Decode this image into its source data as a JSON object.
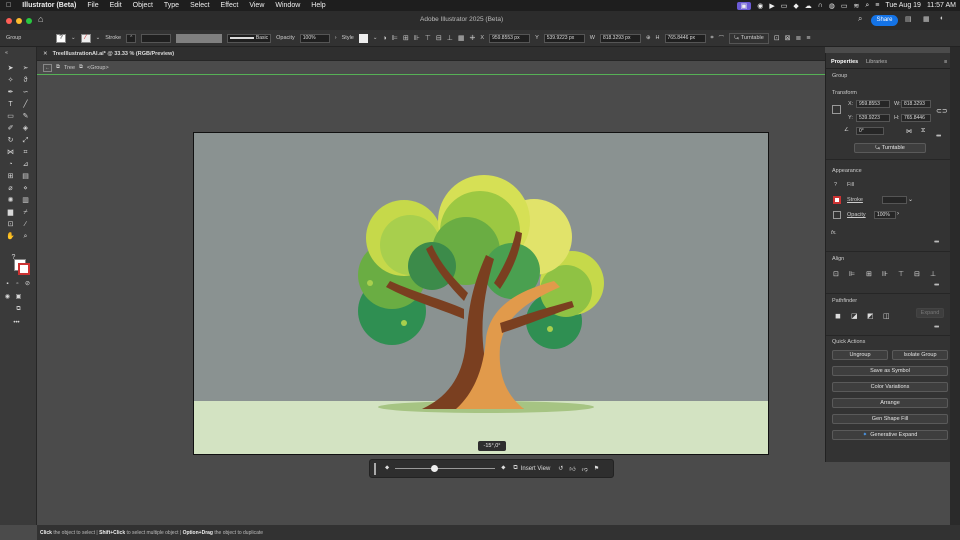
{
  "menubar": {
    "apple": "",
    "app_name": "Illustrator (Beta)",
    "items": [
      "File",
      "Edit",
      "Object",
      "Type",
      "Select",
      "Effect",
      "View",
      "Window",
      "Help"
    ],
    "date": "Tue Aug 19",
    "time": "11:57 AM"
  },
  "app": {
    "window_title": "Adobe Illustrator 2025 (Beta)",
    "share_label": "Share"
  },
  "control_bar": {
    "selection": "Group",
    "stroke_label": "Stroke",
    "stroke_style": "Basic",
    "opacity_label": "Opacity",
    "opacity_value": "100%",
    "style_label": "Style",
    "x_label": "X",
    "x_value": "959.8553 px",
    "y_label": "Y",
    "y_value": "539.9223 px",
    "w_label": "W",
    "w_value": "818.3293 px",
    "h_label": "H",
    "h_value": "765.8446 px",
    "turntable": "Turntable"
  },
  "document": {
    "tab_title": "TreeIllustrationAI.ai* @ 33.33 % (RGB/Preview)",
    "crumb_layer": "Tree",
    "crumb_group": "<Group>"
  },
  "rotation_label": "-15°,0°",
  "contextual_bar": {
    "insert_view": "Insert View",
    "slider_value": 0.38
  },
  "status_bar": {
    "click": "Click",
    "click_text": "the object to select",
    "shift": "Shift+Click",
    "shift_text": "to select multiple object",
    "option": "Option+Drag",
    "option_text": "the object to duplicate"
  },
  "properties": {
    "tab_properties": "Properties",
    "tab_libraries": "Libraries",
    "selection": "Group",
    "transform_title": "Transform",
    "x_label": "X:",
    "x_value": "959.8553",
    "y_label": "Y:",
    "y_value": "539.9223",
    "w_label": "W:",
    "w_value": "818.3293",
    "h_label": "H:",
    "h_value": "765.8446",
    "angle_value": "0°",
    "turntable": "Turntable",
    "appearance_title": "Appearance",
    "fill_label": "Fill",
    "stroke_label": "Stroke",
    "opacity_label": "Opacity",
    "opacity_value": "100%",
    "fx_label": "fx.",
    "align_title": "Align",
    "pathfinder_title": "Pathfinder",
    "expand_label": "Expand",
    "quick_actions_title": "Quick Actions",
    "ungroup": "Ungroup",
    "isolate_group": "Isolate Group",
    "save_symbol": "Save as Symbol",
    "color_variations": "Color Variations",
    "arrange": "Arrange",
    "gen_shape_fill": "Gen Shape Fill",
    "gen_expand": "Generative Expand"
  },
  "colors": {
    "accent": "#1473e6",
    "artboard_bg": "#8a9291",
    "ground": "#d3e3c2",
    "trunk_light": "#e19a4b",
    "trunk_dark": "#7a3f20"
  }
}
